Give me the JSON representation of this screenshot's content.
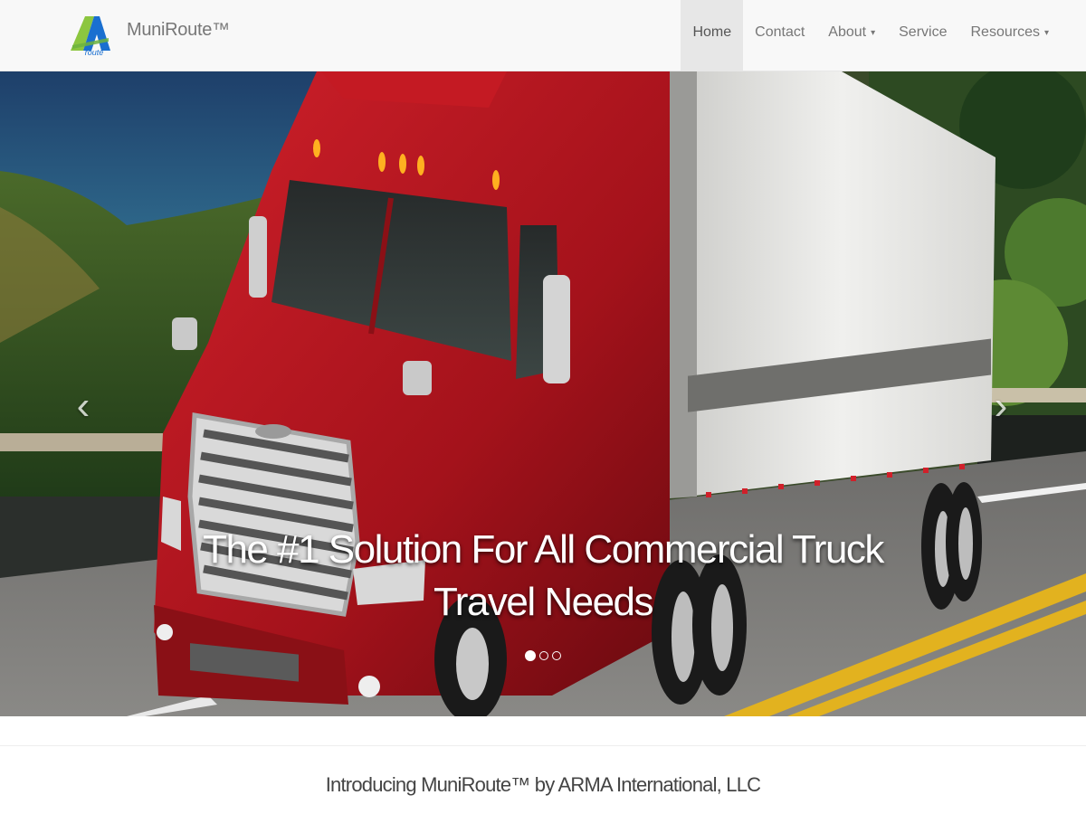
{
  "brand": {
    "logo_text": "route",
    "name": "MuniRoute™"
  },
  "nav": {
    "items": [
      {
        "label": "Home",
        "active": true,
        "dropdown": false
      },
      {
        "label": "Contact",
        "active": false,
        "dropdown": false
      },
      {
        "label": "About",
        "active": false,
        "dropdown": true
      },
      {
        "label": "Service",
        "active": false,
        "dropdown": false
      },
      {
        "label": "Resources",
        "active": false,
        "dropdown": true
      }
    ],
    "caret": "▾"
  },
  "carousel": {
    "caption": "The #1 Solution For All Commercial Truck Travel Needs",
    "prev_glyph": "‹",
    "next_glyph": "›",
    "slide_count": 3,
    "active_slide": 1
  },
  "intro": {
    "text": "Introducing MuniRoute™ by ARMA International, LLC"
  },
  "colors": {
    "navbar_bg": "#f8f8f8",
    "active_nav_bg": "#e7e7e7",
    "truck_red": "#b3141c",
    "trailer_white": "#e8e8e6",
    "logo_blue": "#1a6fd0",
    "logo_green": "#8cc63f"
  }
}
